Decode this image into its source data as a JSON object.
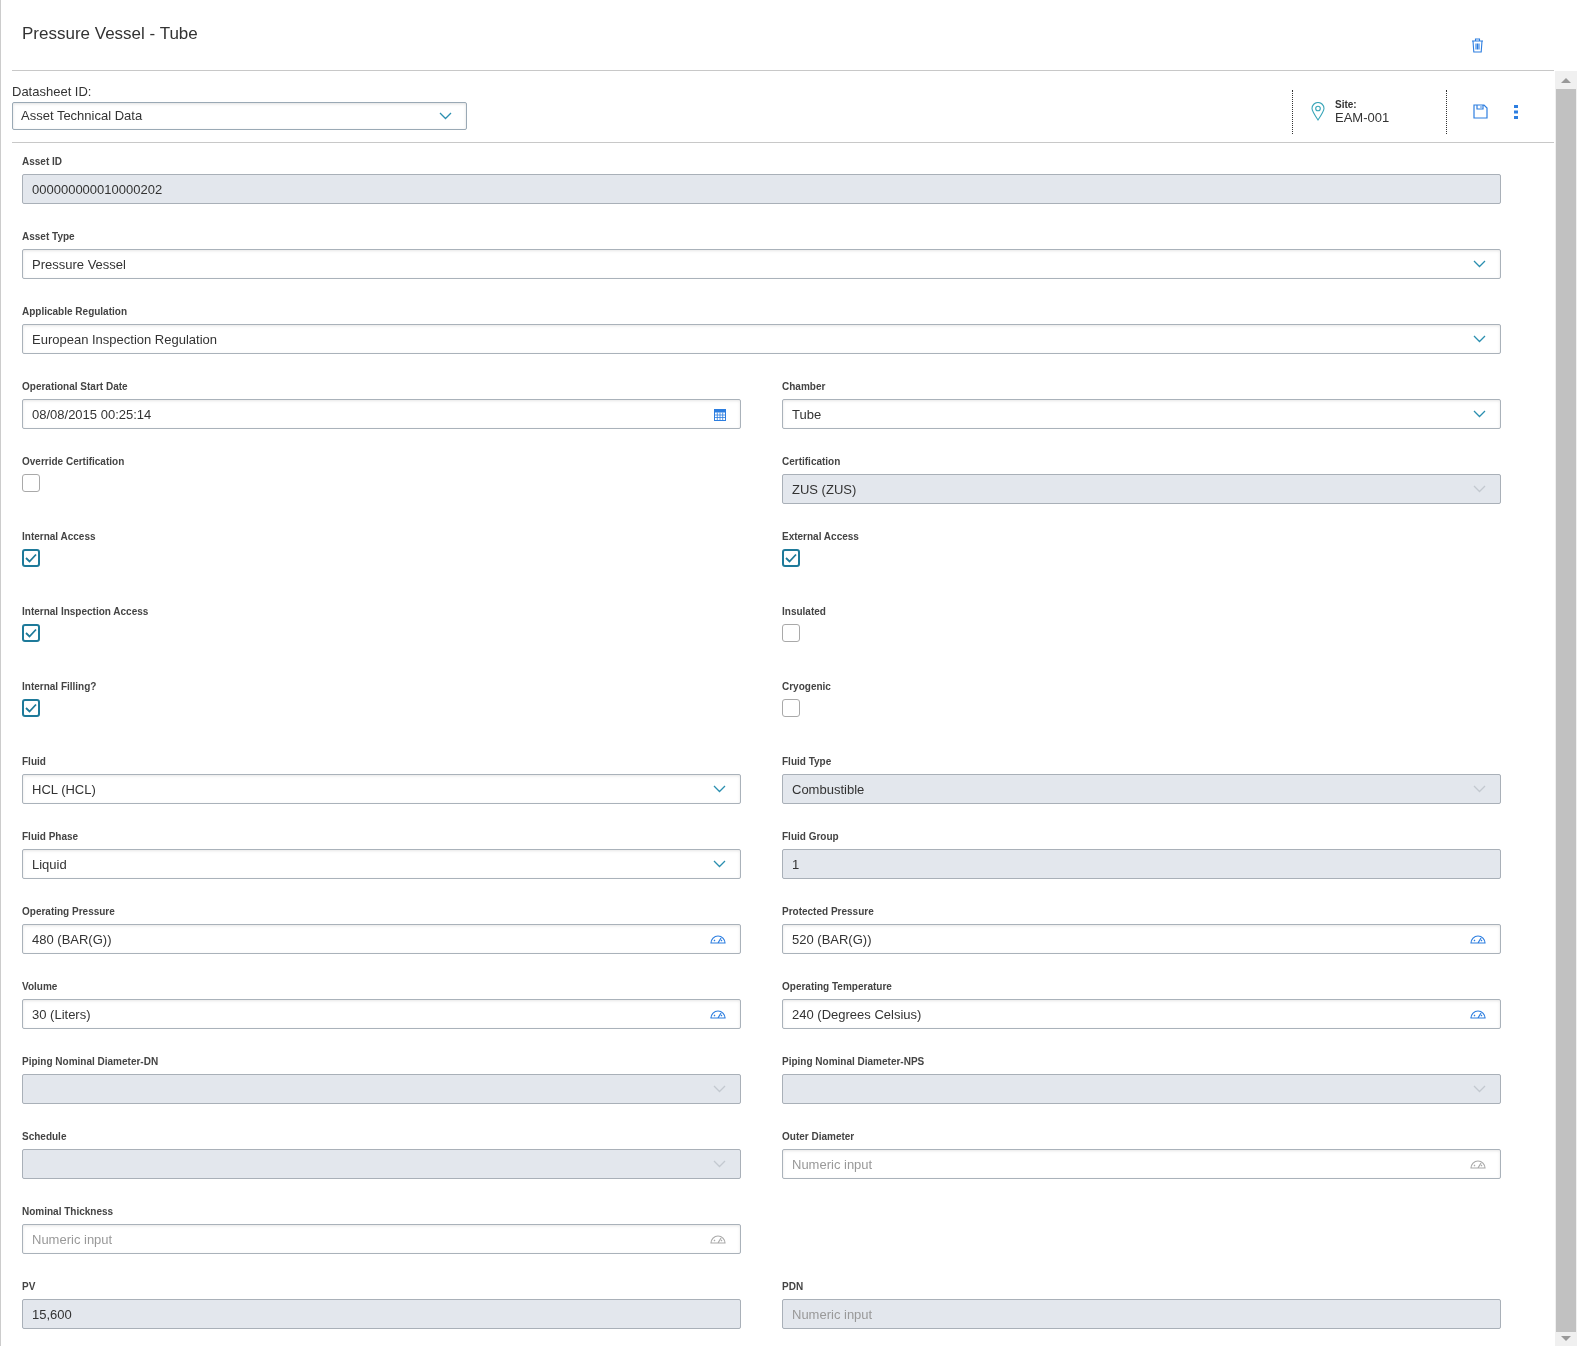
{
  "header": {
    "title": "Pressure Vessel - Tube"
  },
  "toolbar": {
    "datasheet_label": "Datasheet ID:",
    "datasheet_value": "Asset Technical Data",
    "site_label": "Site:",
    "site_value": "EAM-001"
  },
  "rows": [
    {
      "full_width": true,
      "fields": [
        {
          "label": "Asset ID",
          "kind": "text",
          "value": "000000000010000202",
          "disabled": true
        }
      ]
    },
    {
      "full_width": true,
      "fields": [
        {
          "label": "Asset Type",
          "kind": "select",
          "value": "Pressure Vessel",
          "disabled": false
        }
      ]
    },
    {
      "full_width": true,
      "fields": [
        {
          "label": "Applicable Regulation",
          "kind": "select",
          "value": "European Inspection Regulation",
          "disabled": false
        }
      ]
    },
    {
      "full_width": false,
      "fields": [
        {
          "label": "Operational Start Date",
          "kind": "date",
          "value": "08/08/2015 00:25:14",
          "disabled": false
        },
        {
          "label": "Chamber",
          "kind": "select",
          "value": "Tube",
          "disabled": false
        }
      ]
    },
    {
      "full_width": false,
      "fields": [
        {
          "label": "Override Certification",
          "kind": "checkbox",
          "checked": false
        },
        {
          "label": "Certification",
          "kind": "select",
          "value": "ZUS (ZUS)",
          "disabled": true
        }
      ]
    },
    {
      "full_width": false,
      "fields": [
        {
          "label": "Internal Access",
          "kind": "checkbox",
          "checked": true
        },
        {
          "label": "External Access",
          "kind": "checkbox",
          "checked": true
        }
      ]
    },
    {
      "full_width": false,
      "fields": [
        {
          "label": "Internal Inspection Access",
          "kind": "checkbox",
          "checked": true
        },
        {
          "label": "Insulated",
          "kind": "checkbox",
          "checked": false
        }
      ]
    },
    {
      "full_width": false,
      "fields": [
        {
          "label": "Internal Filling?",
          "kind": "checkbox",
          "checked": true
        },
        {
          "label": "Cryogenic",
          "kind": "checkbox",
          "checked": false
        }
      ]
    },
    {
      "full_width": false,
      "fields": [
        {
          "label": "Fluid",
          "kind": "select",
          "value": "HCL (HCL)",
          "disabled": false
        },
        {
          "label": "Fluid Type",
          "kind": "select",
          "value": "Combustible",
          "disabled": true
        }
      ]
    },
    {
      "full_width": false,
      "fields": [
        {
          "label": "Fluid Phase",
          "kind": "select",
          "value": "Liquid",
          "disabled": false
        },
        {
          "label": "Fluid Group",
          "kind": "text",
          "value": "1",
          "disabled": true
        }
      ]
    },
    {
      "full_width": false,
      "fields": [
        {
          "label": "Operating Pressure",
          "kind": "measure",
          "value": "480 (BAR(G))",
          "disabled": false
        },
        {
          "label": "Protected Pressure",
          "kind": "measure",
          "value": "520 (BAR(G))",
          "disabled": false
        }
      ]
    },
    {
      "full_width": false,
      "fields": [
        {
          "label": "Volume",
          "kind": "measure",
          "value": "30 (Liters)",
          "disabled": false
        },
        {
          "label": "Operating Temperature",
          "kind": "measure",
          "value": "240 (Degrees Celsius)",
          "disabled": false
        }
      ]
    },
    {
      "full_width": false,
      "fields": [
        {
          "label": "Piping Nominal Diameter-DN",
          "kind": "select",
          "disabled": true
        },
        {
          "label": "Piping Nominal Diameter-NPS",
          "kind": "select",
          "disabled": true
        }
      ]
    },
    {
      "full_width": false,
      "fields": [
        {
          "label": "Schedule",
          "kind": "select",
          "disabled": true
        },
        {
          "label": "Outer Diameter",
          "kind": "measure",
          "placeholder": "Numeric input",
          "disabled": false
        }
      ]
    },
    {
      "full_width": false,
      "fields": [
        {
          "label": "Nominal Thickness",
          "kind": "measure",
          "placeholder": "Numeric input",
          "disabled": false
        }
      ]
    },
    {
      "full_width": false,
      "fields": [
        {
          "label": "PV",
          "kind": "text",
          "value": "15,600",
          "disabled": true
        },
        {
          "label": "PDN",
          "kind": "text",
          "placeholder": "Numeric input",
          "disabled": true
        }
      ]
    }
  ]
}
